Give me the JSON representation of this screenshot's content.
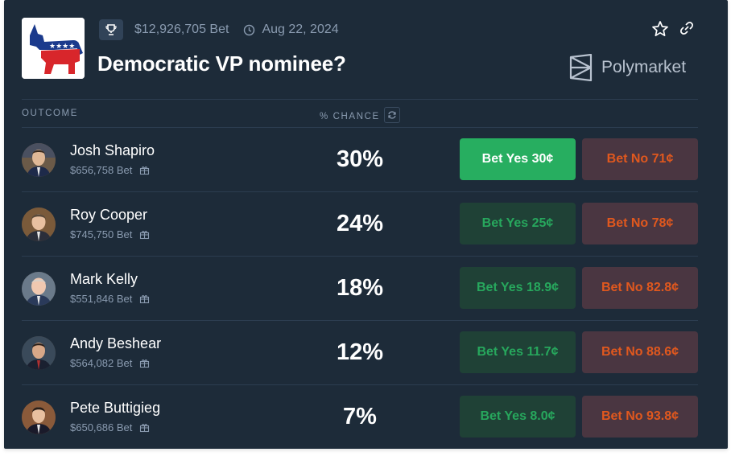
{
  "header": {
    "volume": "$12,926,705 Bet",
    "date": "Aug 22, 2024",
    "title": "Democratic VP nominee?",
    "brand": "Polymarket"
  },
  "columns": {
    "outcome": "OUTCOME",
    "chance": "% CHANCE"
  },
  "outcomes": [
    {
      "name": "Josh Shapiro",
      "volume": "$656,758 Bet",
      "chance": "30%",
      "yes": "Bet Yes 30¢",
      "no": "Bet No 71¢",
      "yes_active": true
    },
    {
      "name": "Roy Cooper",
      "volume": "$745,750 Bet",
      "chance": "24%",
      "yes": "Bet Yes 25¢",
      "no": "Bet No 78¢",
      "yes_active": false
    },
    {
      "name": "Mark Kelly",
      "volume": "$551,846 Bet",
      "chance": "18%",
      "yes": "Bet Yes 18.9¢",
      "no": "Bet No 82.8¢",
      "yes_active": false
    },
    {
      "name": "Andy Beshear",
      "volume": "$564,082 Bet",
      "chance": "12%",
      "yes": "Bet Yes 11.7¢",
      "no": "Bet No 88.6¢",
      "yes_active": false
    },
    {
      "name": "Pete Buttigieg",
      "volume": "$650,686 Bet",
      "chance": "7%",
      "yes": "Bet Yes 8.0¢",
      "no": "Bet No 93.8¢",
      "yes_active": false
    }
  ],
  "colors": {
    "background": "#1d2b39",
    "yes": "#27ae60",
    "no_text": "#e0581e"
  },
  "icons": {
    "market": "democratic-donkey-logo",
    "trophy": "trophy-icon",
    "clock": "clock-icon",
    "star": "star-icon",
    "link": "link-icon",
    "gift": "gift-icon",
    "refresh": "refresh-icon"
  }
}
